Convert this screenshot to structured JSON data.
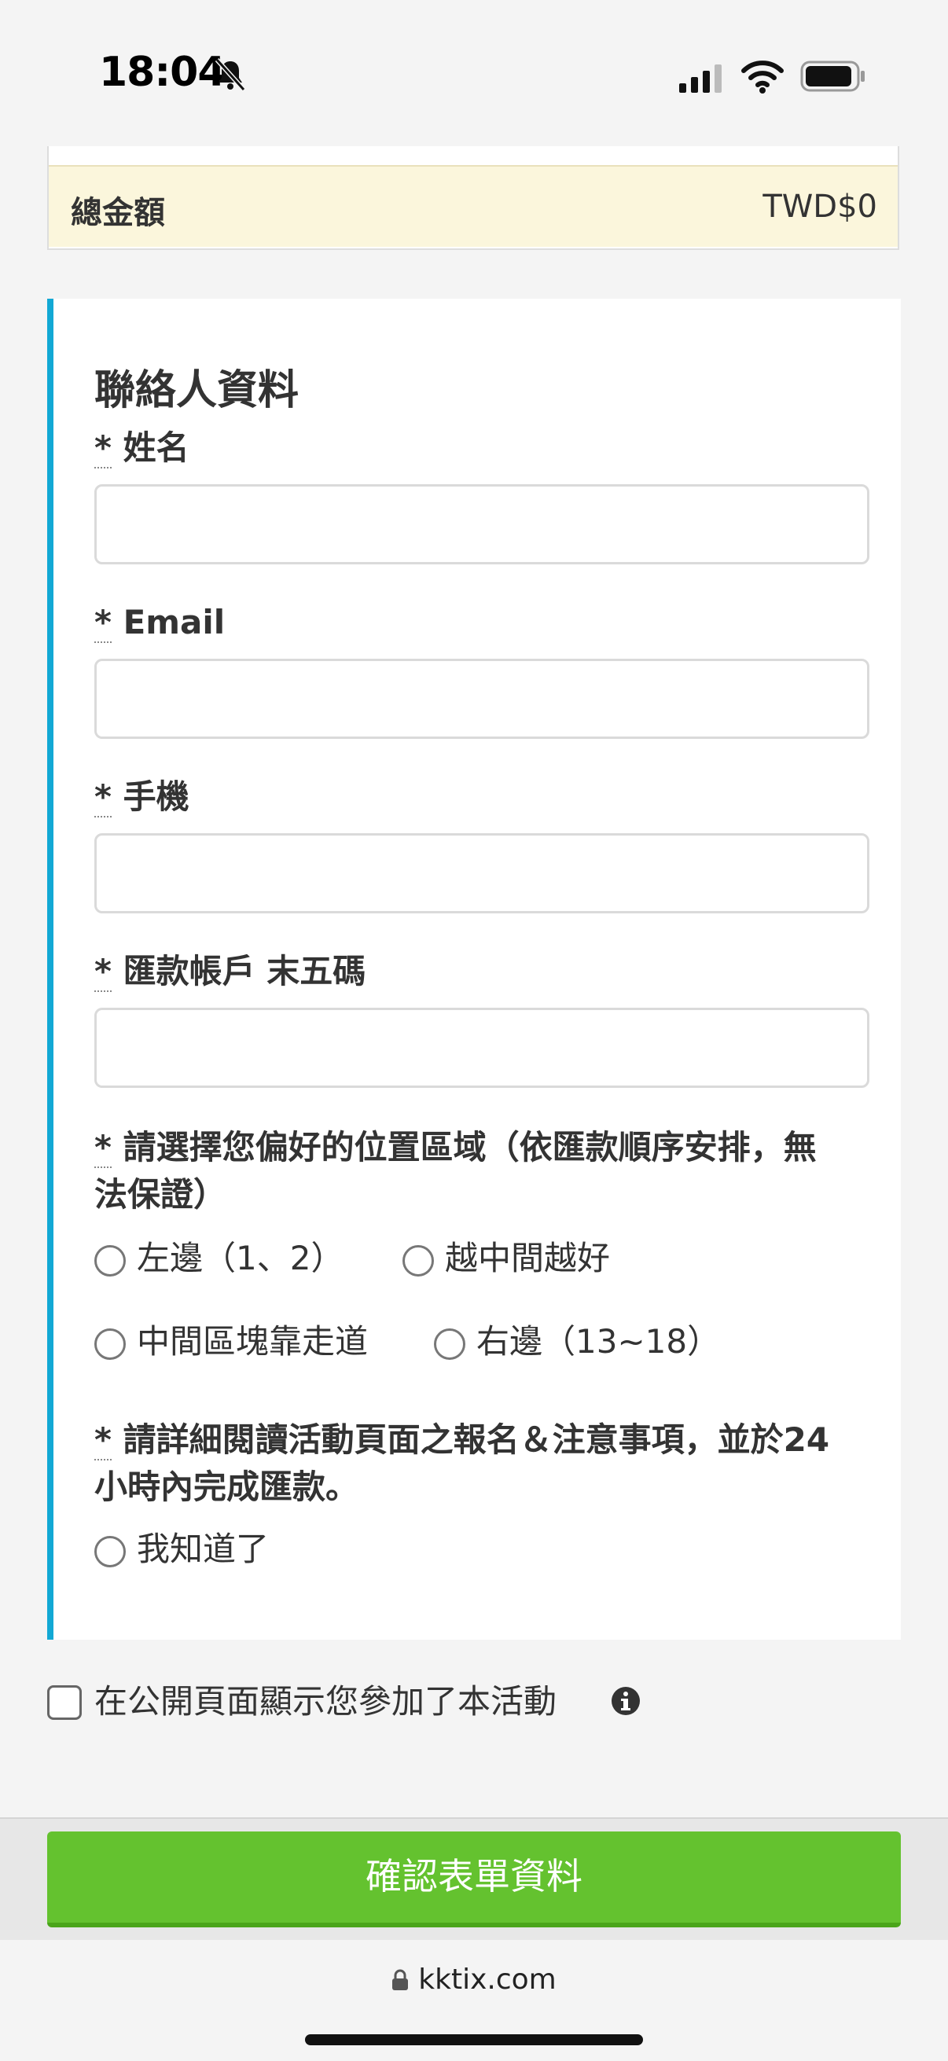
{
  "status_bar": {
    "time": "18:04",
    "icons": [
      "bell-slash-icon",
      "signal-icon",
      "wifi-icon",
      "battery-icon"
    ]
  },
  "summary": {
    "total_label": "總金額",
    "total_value": "TWD$0"
  },
  "form": {
    "title": "聯絡人資料",
    "required_mark": "*",
    "fields": [
      {
        "label": "姓名",
        "value": ""
      },
      {
        "label": "Email",
        "value": ""
      },
      {
        "label": "手機",
        "value": ""
      },
      {
        "label": "匯款帳戶 末五碼",
        "value": ""
      }
    ],
    "seat_question": {
      "label_line1": "請選擇您偏好的位置區域（依匯款順序安排，無",
      "label_line2": "法保證）",
      "options": [
        "左邊（1、2）",
        "越中間越好",
        "中間區塊靠走道",
        "右邊（13~18）"
      ]
    },
    "notice_question": {
      "label_line1": "請詳細閱讀活動頁面之報名＆注意事項，並於24",
      "label_line2": "小時內完成匯款。",
      "options": [
        "我知道了"
      ]
    }
  },
  "public_display": {
    "label": "在公開頁面顯示您參加了本活動"
  },
  "actions": {
    "confirm_label": "確認表單資料"
  },
  "browser": {
    "url": "kktix.com"
  },
  "colors": {
    "accent_blue": "#12a8d4",
    "confirm_green": "#64c22f",
    "summary_bg": "#fbf6dc"
  }
}
